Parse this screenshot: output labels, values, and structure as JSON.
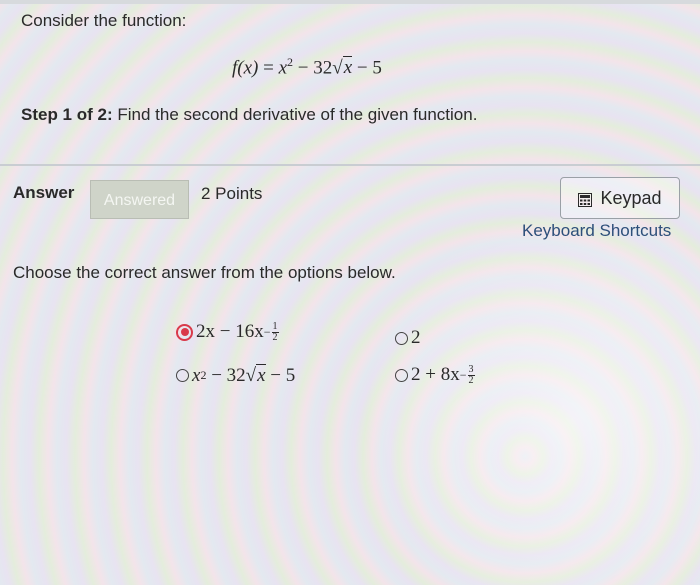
{
  "question": {
    "intro": "Consider the function:",
    "function": {
      "lhs": "f(x)",
      "eq": "=",
      "x": "x",
      "exp2": "2",
      "minus": "−",
      "coeff": "32",
      "sqrt_symbol": "√",
      "sqrt_arg": "x",
      "const": "5"
    },
    "step_prefix": "Step 1 of 2:",
    "step_text": "Find the second derivative of the given function."
  },
  "answer": {
    "label": "Answer",
    "status": "Answered",
    "points": "2 Points",
    "keypad_label": "Keypad",
    "shortcuts_label": "Keyboard Shortcuts",
    "instructions": "Choose the correct answer from the options below."
  },
  "options": [
    {
      "selected": true,
      "lead": "2x − 16x",
      "exp_sign": "−",
      "exp_num": "1",
      "exp_den": "2"
    },
    {
      "selected": false,
      "lead": "2"
    },
    {
      "selected": false,
      "x": "x",
      "exp2": "2",
      "mid": "− 32",
      "sqrt_symbol": "√",
      "sqrt_arg": "x",
      "tail": "− 5"
    },
    {
      "selected": false,
      "lead": "2 + 8x",
      "exp_sign": "−",
      "exp_num": "3",
      "exp_den": "2"
    }
  ],
  "colors": {
    "radio_selected": "#d93a4a",
    "link": "#2d4f7a",
    "answered_badge_bg": "#cfd4c9"
  },
  "icons": {
    "keypad": "calculator-icon"
  }
}
